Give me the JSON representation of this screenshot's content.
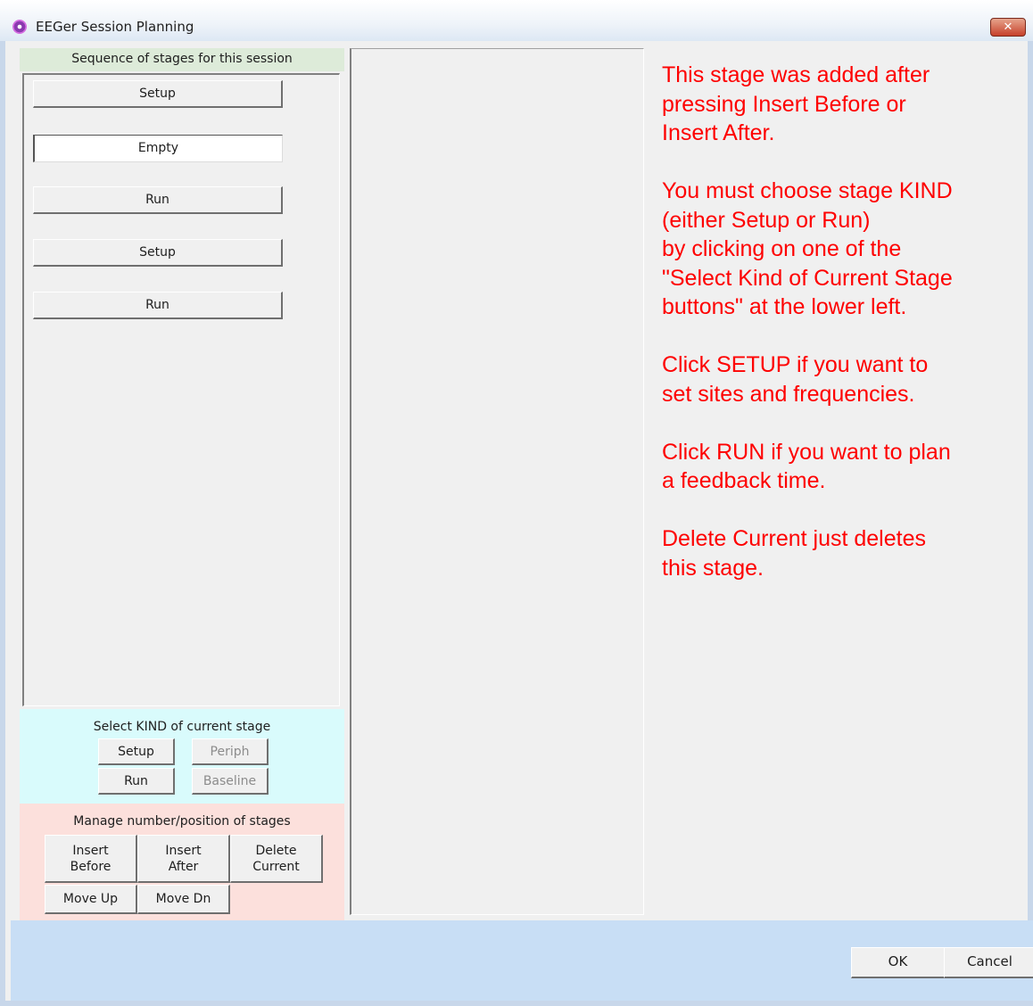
{
  "window": {
    "title": "EEGer Session Planning",
    "close_label": "✕"
  },
  "sequence": {
    "header": "Sequence of stages for this session",
    "stages": [
      {
        "label": "Setup",
        "state": "normal"
      },
      {
        "label": "Empty",
        "state": "selected"
      },
      {
        "label": "Run",
        "state": "normal"
      },
      {
        "label": "Setup",
        "state": "normal"
      },
      {
        "label": "Run",
        "state": "normal"
      }
    ]
  },
  "kind": {
    "label": "Select KIND of current stage",
    "setup": "Setup",
    "periph": "Periph",
    "run": "Run",
    "baseline": "Baseline"
  },
  "manage": {
    "label": "Manage number/position of stages",
    "insert_before": "Insert\nBefore",
    "insert_after": "Insert\nAfter",
    "delete_current": "Delete\nCurrent",
    "move_up": "Move Up",
    "move_dn": "Move Dn"
  },
  "info": {
    "text": "This stage was added after\npressing Insert Before or\nInsert After.\n\nYou must choose stage KIND\n(either Setup or Run)\nby clicking on one of the\n\"Select Kind of Current Stage\nbuttons\" at the lower left.\n\nClick SETUP if you want to\nset sites and frequencies.\n\nClick RUN if you want to plan\na feedback time.\n\nDelete Current just deletes\nthis stage."
  },
  "footer": {
    "ok": "OK",
    "cancel": "Cancel"
  },
  "colors": {
    "info_text": "#fe0000",
    "sequence_header_bg": "#ddebd9",
    "kind_section_bg": "#d9fbfc",
    "manage_section_bg": "#fce0dc",
    "bottom_bar_bg": "#c8def5"
  }
}
